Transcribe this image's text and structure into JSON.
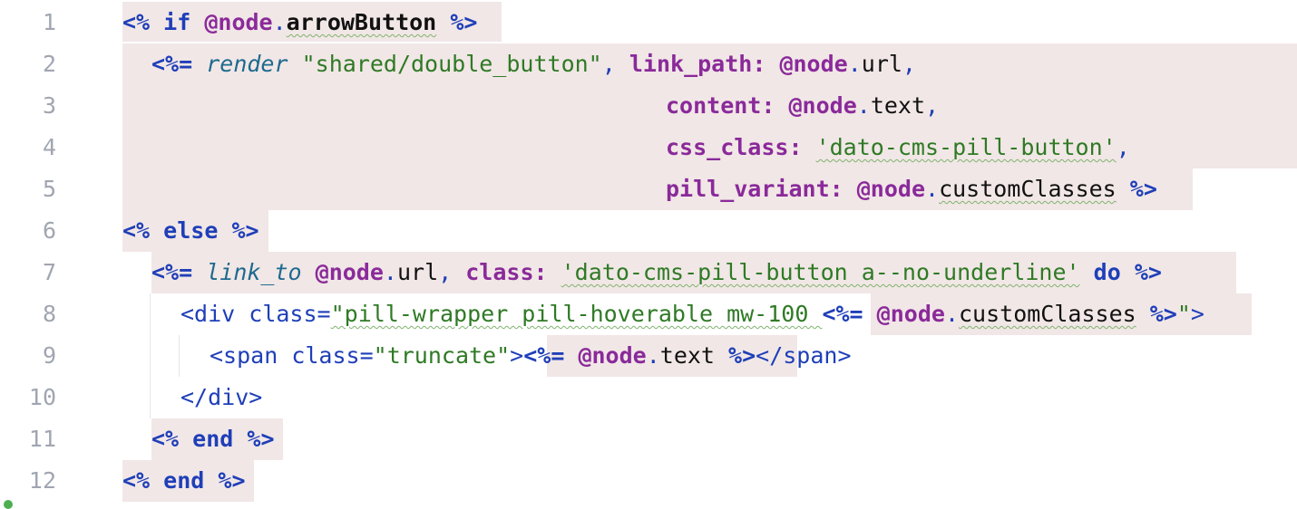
{
  "editor": {
    "line_numbers": [
      "1",
      "2",
      "3",
      "4",
      "5",
      "6",
      "7",
      "8",
      "9",
      "10",
      "11",
      "12"
    ],
    "lines": {
      "l1": {
        "open": "<%",
        "kw": "if",
        "ivar": "@node",
        "dot": ".",
        "meth": "arrowButton",
        "close": "%>"
      },
      "l2": {
        "open": "<%=",
        "call": "render",
        "str": "\"shared/double_button\"",
        "comma": ",",
        "key": "link_path:",
        "ivar": "@node",
        "dot": ".",
        "meth": "url",
        "comma2": ","
      },
      "l3": {
        "key": "content:",
        "ivar": "@node",
        "dot": ".",
        "meth": "text",
        "comma": ","
      },
      "l4": {
        "key": "css_class:",
        "str": "'dato-cms-pill-button'",
        "comma": ","
      },
      "l5": {
        "key": "pill_variant:",
        "ivar": "@node",
        "dot": ".",
        "meth": "customClasses",
        "close": "%>"
      },
      "l6": {
        "open": "<%",
        "kw": "else",
        "close": "%>"
      },
      "l7": {
        "open": "<%=",
        "call": "link_to",
        "ivar": "@node",
        "dot": ".",
        "meth": "url",
        "comma": ",",
        "key": "class:",
        "str": "'dato-cms-pill-button a--no-underline'",
        "kw": "do",
        "close": "%>"
      },
      "l8": {
        "tag_open": "<div",
        "attr": "class=",
        "str_open": "\"pill-wrapper pill-hoverable mw-100 ",
        "erb_open": "<%=",
        "ivar": "@node",
        "dot": ".",
        "meth": "customClasses",
        "erb_close": "%>",
        "str_close": "\"",
        "tag_end": ">"
      },
      "l9": {
        "tag_open": "<span",
        "attr": "class=",
        "str": "\"truncate\"",
        "gt": ">",
        "erb_open": "<%=",
        "ivar": "@node",
        "dot": ".",
        "meth": "text",
        "erb_close": "%>",
        "tag_close": "</span>"
      },
      "l10": {
        "tag_close": "</div>"
      },
      "l11": {
        "open": "<%",
        "kw": "end",
        "close": "%>"
      },
      "l12": {
        "open": "<%",
        "kw": "end",
        "close": "%>"
      }
    }
  },
  "colors": {
    "erb_block_bg": "#f1e7e6",
    "keyword": "#1f3fb8",
    "instance_var": "#8a2a9a",
    "string": "#2f7a25",
    "method_call": "#1d6a8f",
    "line_number": "#a0a6b1"
  }
}
